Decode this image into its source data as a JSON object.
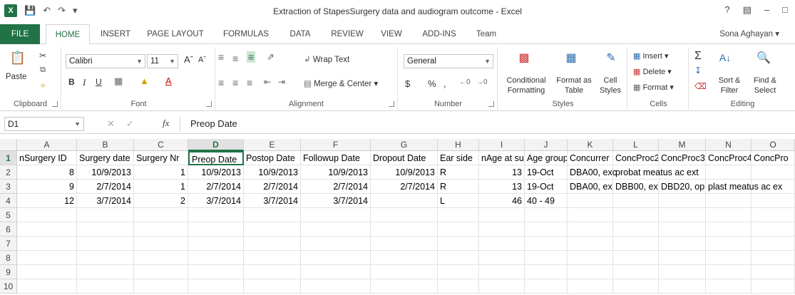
{
  "window": {
    "title": "Extraction of StapesSurgery data and audiogram outcome - Excel",
    "help": "?",
    "logo": "X"
  },
  "tabs": [
    "FILE",
    "HOME",
    "INSERT",
    "PAGE LAYOUT",
    "FORMULAS",
    "DATA",
    "REVIEW",
    "VIEW",
    "ADD-INS",
    "Team"
  ],
  "user": "Sona Aghayan",
  "ribbon": {
    "clipboard": {
      "label": "Clipboard",
      "paste": "Paste"
    },
    "font": {
      "label": "Font",
      "name": "Calibri",
      "size": "11",
      "bold": "B",
      "italic": "I",
      "underline": "U"
    },
    "alignment": {
      "label": "Alignment",
      "wrap": "Wrap Text",
      "merge": "Merge & Center"
    },
    "number": {
      "label": "Number",
      "format": "General",
      "currency": "$",
      "percent": "%",
      "comma": ","
    },
    "styles": {
      "label": "Styles",
      "conditional": "Conditional Formatting",
      "format_table": "Format as Table",
      "cell_styles": "Cell Styles"
    },
    "cells": {
      "label": "Cells",
      "insert": "Insert",
      "delete": "Delete",
      "format": "Format"
    },
    "editing": {
      "label": "Editing",
      "sort": "Sort & Filter",
      "find": "Find & Select"
    }
  },
  "formula_bar": {
    "name_box": "D1",
    "fx": "fx",
    "content": "Preop Date"
  },
  "columns": [
    "A",
    "B",
    "C",
    "D",
    "E",
    "F",
    "G",
    "H",
    "I",
    "J",
    "K",
    "L",
    "M",
    "N",
    "O"
  ],
  "rows": [
    [
      "nSurgery ID",
      "Surgery date",
      "Surgery Nr",
      "Preop Date",
      "Postop Date",
      "Followup Date",
      "Dropout Date",
      "Ear side",
      "nAge at su",
      "Age group",
      "Concurrer",
      "ConcProc2",
      "ConcProc3",
      "ConcProc4",
      "ConcPro"
    ],
    [
      "8",
      "10/9/2013",
      "1",
      "10/9/2013",
      "10/9/2013",
      "10/9/2013",
      "10/9/2013",
      "R",
      "13",
      "19-Oct",
      "DBA00, exc",
      "probat meatus ac ext",
      "",
      "",
      ""
    ],
    [
      "9",
      "2/7/2014",
      "1",
      "2/7/2014",
      "2/7/2014",
      "2/7/2014",
      "2/7/2014",
      "R",
      "13",
      "19-Oct",
      "DBA00, ex",
      "DBB00, ex",
      "DBD20, op",
      "plast meatus ac ex",
      ""
    ],
    [
      "12",
      "3/7/2014",
      "2",
      "3/7/2014",
      "3/7/2014",
      "3/7/2014",
      "",
      "L",
      "46",
      "40 - 49",
      "",
      "",
      "",
      "",
      ""
    ],
    [
      "",
      "",
      "",
      "",
      "",
      "",
      "",
      "",
      "",
      "",
      "",
      "",
      "",
      "",
      ""
    ],
    [
      "",
      "",
      "",
      "",
      "",
      "",
      "",
      "",
      "",
      "",
      "",
      "",
      "",
      "",
      ""
    ],
    [
      "",
      "",
      "",
      "",
      "",
      "",
      "",
      "",
      "",
      "",
      "",
      "",
      "",
      "",
      ""
    ],
    [
      "",
      "",
      "",
      "",
      "",
      "",
      "",
      "",
      "",
      "",
      "",
      "",
      "",
      "",
      ""
    ],
    [
      "",
      "",
      "",
      "",
      "",
      "",
      "",
      "",
      "",
      "",
      "",
      "",
      "",
      "",
      ""
    ],
    [
      "",
      "",
      "",
      "",
      "",
      "",
      "",
      "",
      "",
      "",
      "",
      "",
      "",
      "",
      ""
    ]
  ],
  "accent": "#217346"
}
